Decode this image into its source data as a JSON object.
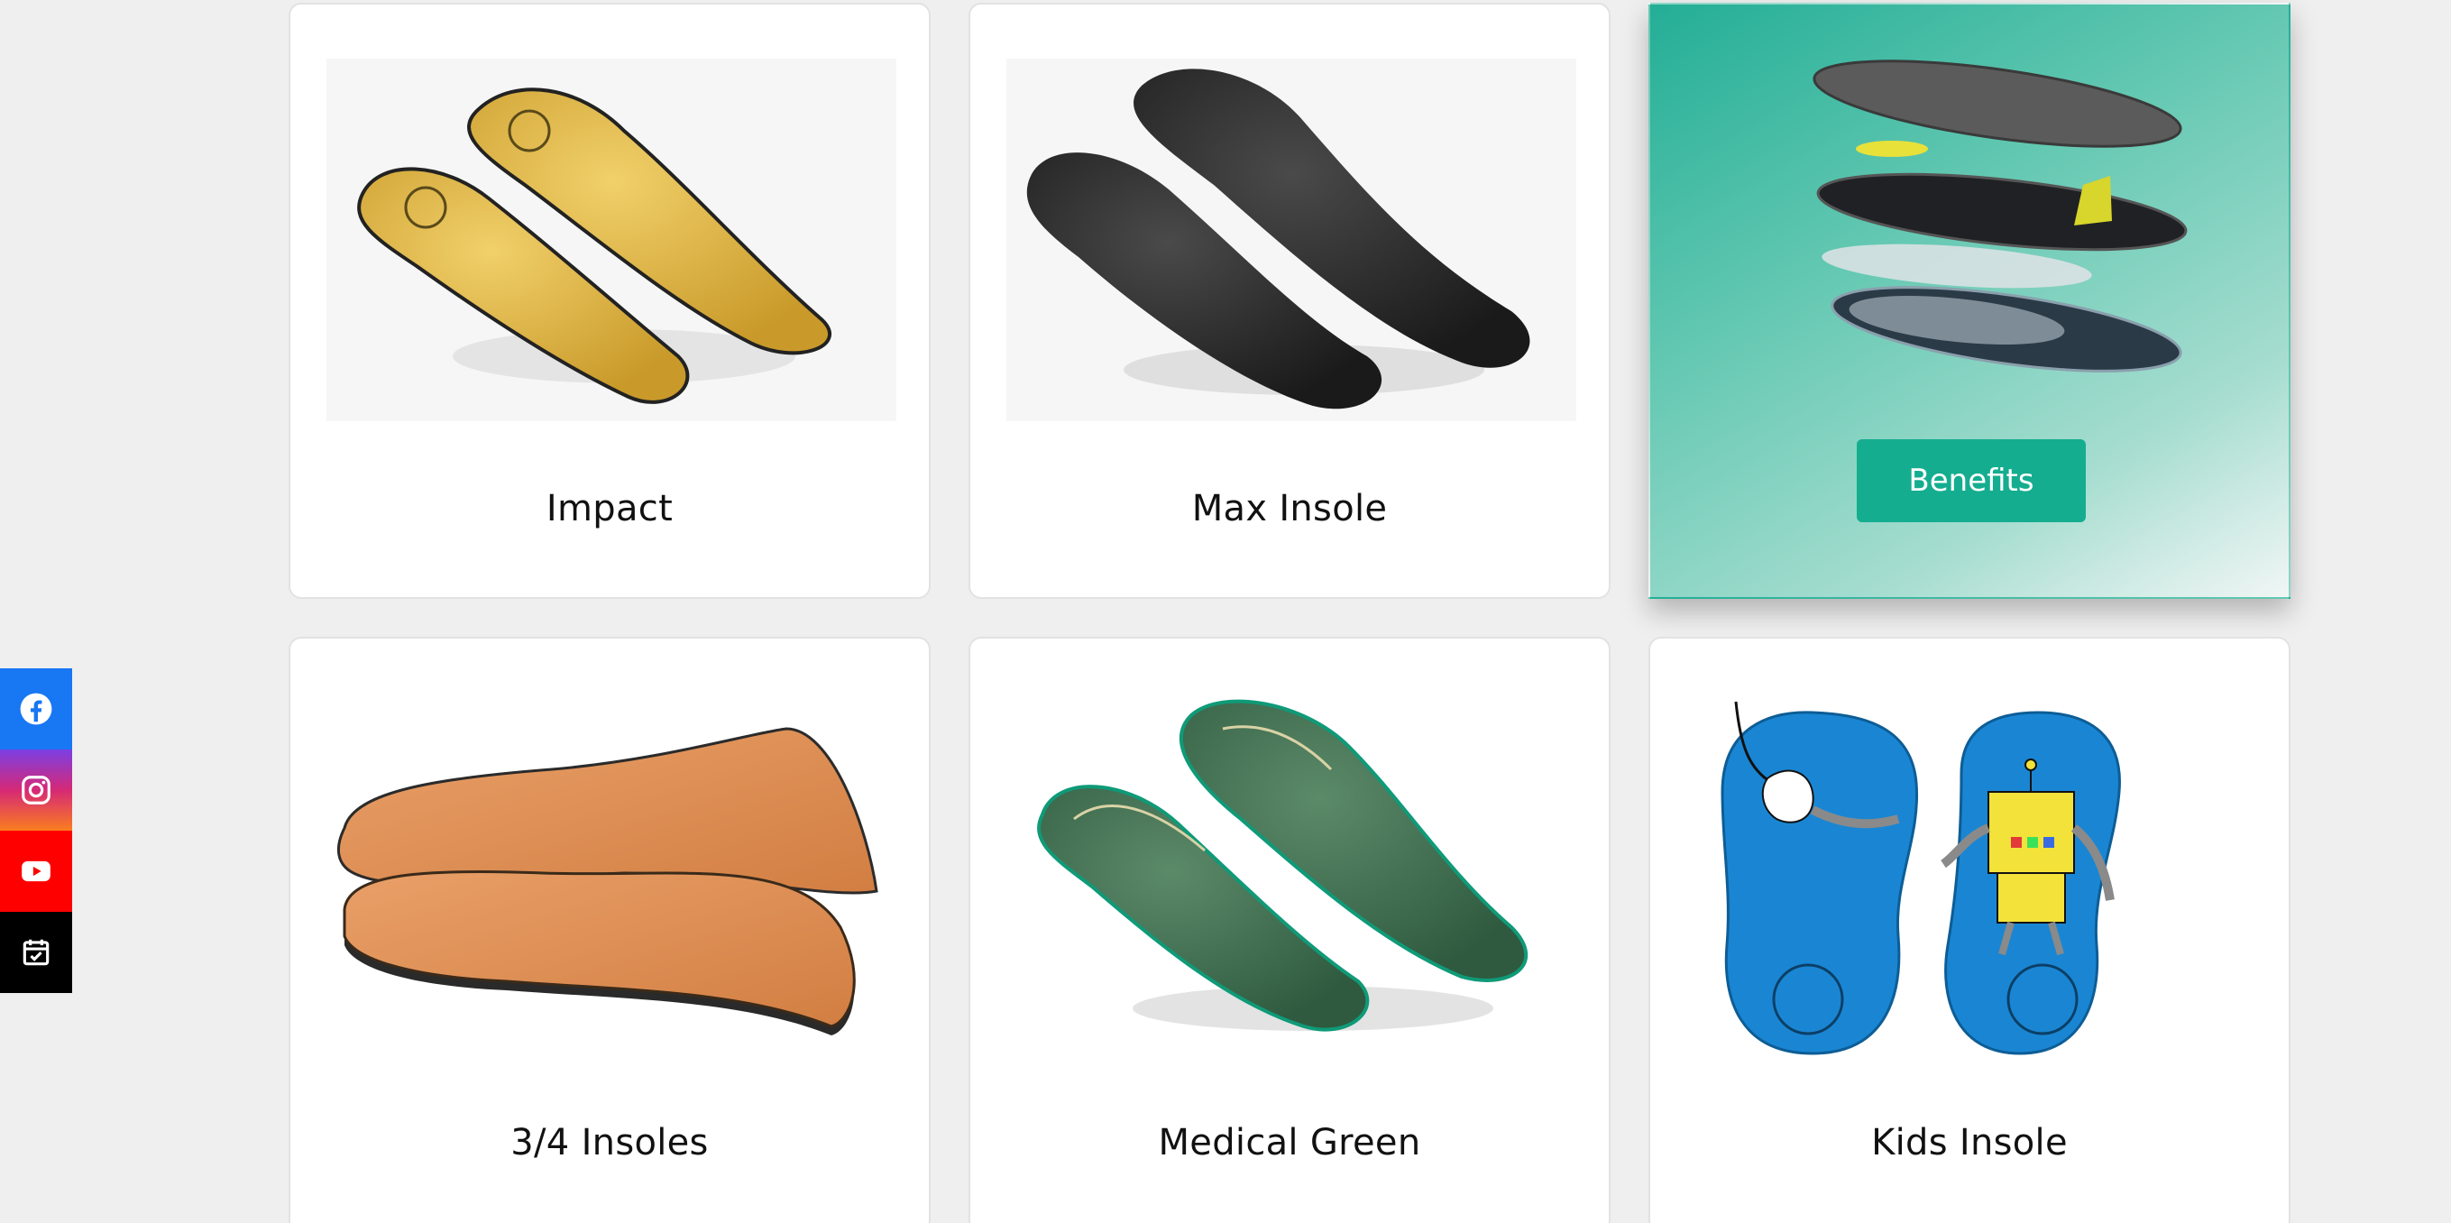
{
  "social": {
    "facebook": {
      "icon": "facebook-icon",
      "color": "#1877f2"
    },
    "instagram": {
      "icon": "instagram-icon"
    },
    "youtube": {
      "icon": "youtube-icon",
      "color": "#ff0000"
    },
    "calendar": {
      "icon": "calendar-check-icon",
      "color": "#000000"
    }
  },
  "products": [
    {
      "title": "Impact",
      "image": "yellow-insole-pair-image",
      "color": "#e2b94a"
    },
    {
      "title": "Max Insole",
      "image": "black-insole-pair-image",
      "color": "#2b2b2b"
    },
    {
      "title": "",
      "image": "insole-layers-exploded-image",
      "button": "Benefits",
      "accent": "#15ad8f"
    },
    {
      "title": "3/4 Insoles",
      "image": "leather-three-quarter-insole-image",
      "color": "#e39558"
    },
    {
      "title": "Medical Green",
      "image": "green-insole-pair-image",
      "color": "#3f6b4f"
    },
    {
      "title": "Kids Insole",
      "image": "kids-blue-robot-insole-image",
      "color": "#1a86d3"
    }
  ]
}
